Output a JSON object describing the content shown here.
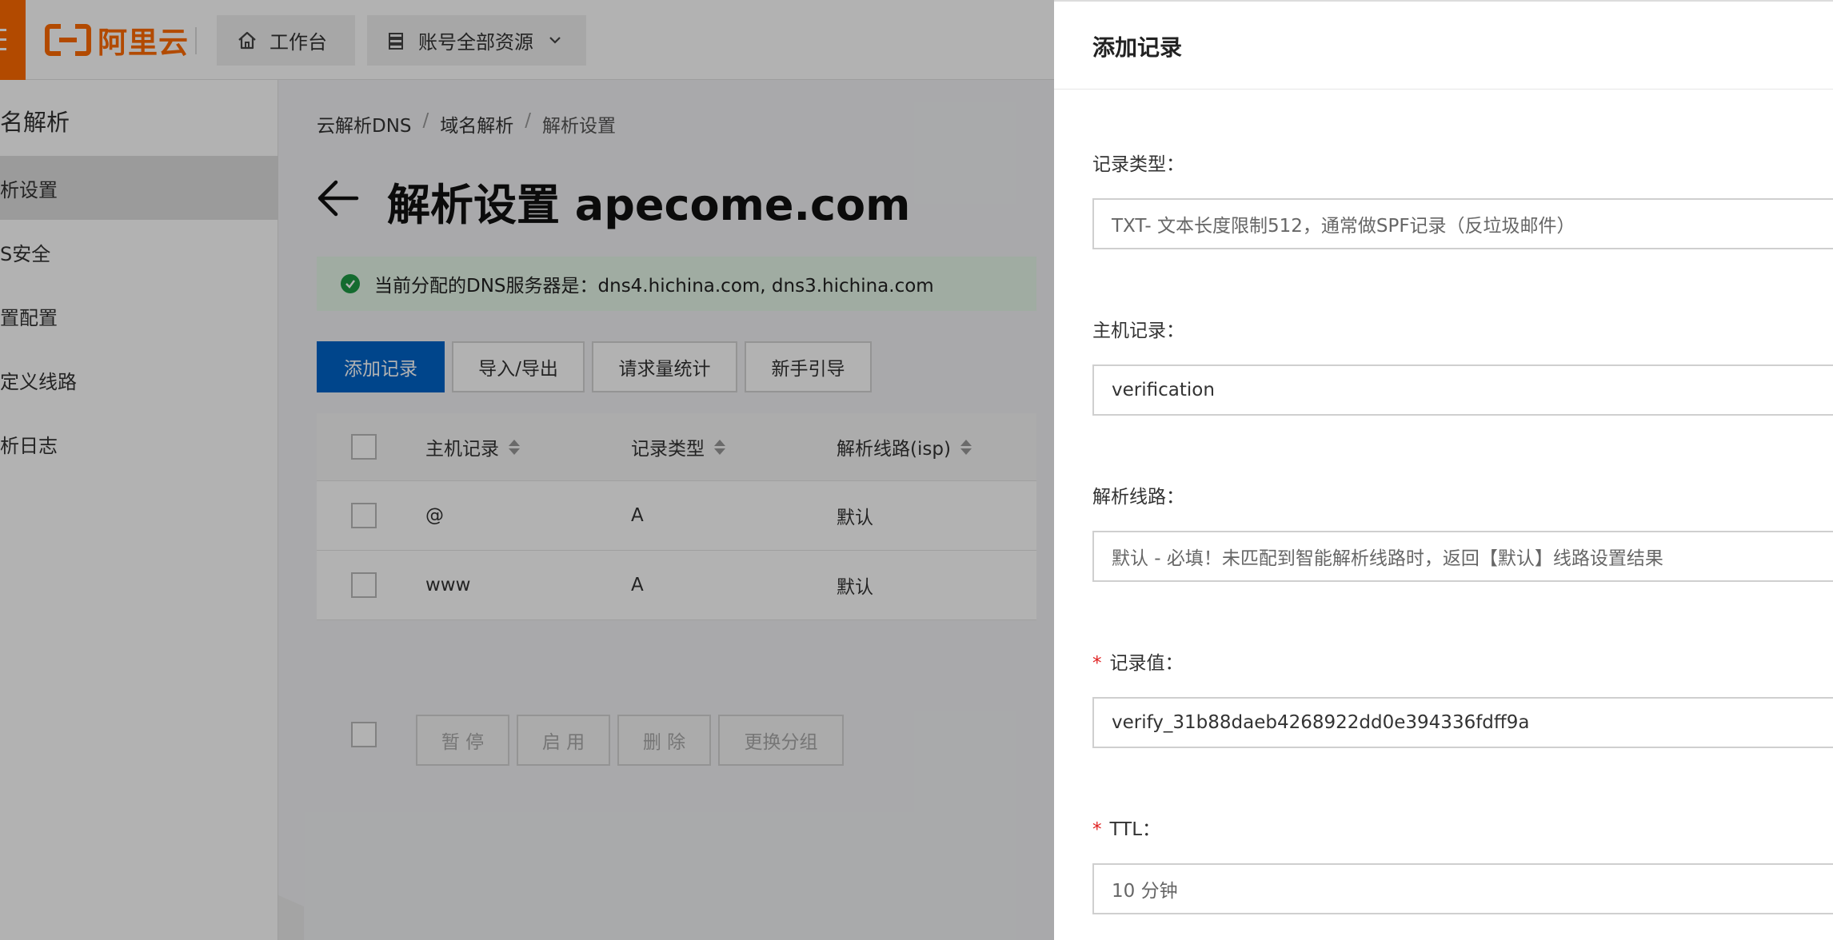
{
  "header": {
    "logo_text": "阿里云",
    "workbench_label": "工作台",
    "resources_label": "账号全部资源"
  },
  "sidebar": {
    "title": "名解析",
    "items": [
      {
        "label": "析设置",
        "active": true
      },
      {
        "label": "S安全",
        "active": false
      },
      {
        "label": "置配置",
        "active": false
      },
      {
        "label": "定义线路",
        "active": false
      },
      {
        "label": "析日志",
        "active": false
      }
    ]
  },
  "main": {
    "breadcrumb": [
      "云解析DNS",
      "域名解析",
      "解析设置"
    ],
    "breadcrumb_sep": "/",
    "page_title": "解析设置 apecome.com",
    "dns_alert": "当前分配的DNS服务器是：dns4.hichina.com, dns3.hichina.com",
    "toolbar": [
      "添加记录",
      "导入/导出",
      "请求量统计",
      "新手引导"
    ],
    "table": {
      "columns": [
        "主机记录",
        "记录类型",
        "解析线路(isp)"
      ],
      "rows": [
        {
          "host": "@",
          "type": "A",
          "line": "默认"
        },
        {
          "host": "www",
          "type": "A",
          "line": "默认"
        }
      ]
    },
    "bulk_actions": [
      "暂 停",
      "启 用",
      "删 除",
      "更换分组"
    ]
  },
  "drawer": {
    "title": "添加记录",
    "fields": {
      "record_type": {
        "label": "记录类型：",
        "value": "TXT- 文本长度限制512，通常做SPF记录（反垃圾邮件）"
      },
      "host": {
        "label": "主机记录：",
        "value": "verification"
      },
      "line": {
        "label": "解析线路：",
        "value": "默认 - 必填！未匹配到智能解析线路时，返回【默认】线路设置结果"
      },
      "value": {
        "label": "记录值：",
        "required": true,
        "value": "verify_31b88daeb4268922dd0e394336fdff9a"
      },
      "ttl": {
        "label": "TTL：",
        "required": true,
        "value": "10 分钟"
      }
    }
  },
  "colors": {
    "brand": "#ff6a00",
    "primary": "#0064c8",
    "success": "#1e9a44",
    "required": "#e02020"
  },
  "icons": [
    "menu-icon",
    "home-icon",
    "list-icon",
    "chevron-down-icon",
    "back-arrow-icon",
    "success-check-icon",
    "sort-icon"
  ]
}
